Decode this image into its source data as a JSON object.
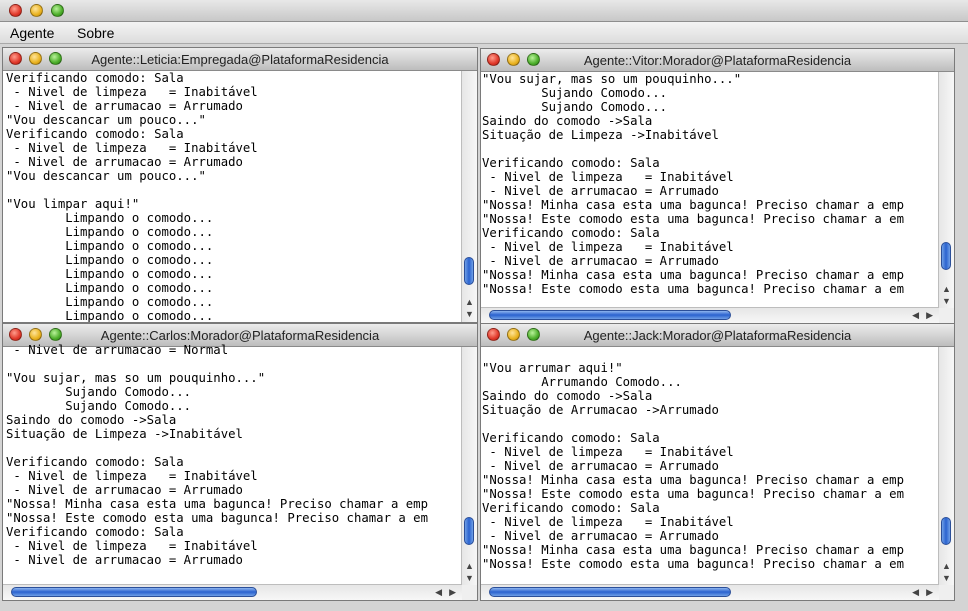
{
  "menubar": {
    "items": [
      "Agente",
      "Sobre"
    ]
  },
  "windows": [
    {
      "title": "Agente::Leticia:Empregada@PlataformaResidencia",
      "lines": [
        "Verificando comodo: Sala",
        " - Nivel de limpeza   = Inabitável",
        " - Nivel de arrumacao = Arrumado",
        "\"Vou descancar um pouco...\"",
        "Verificando comodo: Sala",
        " - Nivel de limpeza   = Inabitável",
        " - Nivel de arrumacao = Arrumado",
        "\"Vou descancar um pouco...\"",
        "",
        "\"Vou limpar aqui!\"",
        "        Limpando o comodo...",
        "        Limpando o comodo...",
        "        Limpando o comodo...",
        "        Limpando o comodo...",
        "        Limpando o comodo...",
        "        Limpando o comodo...",
        "        Limpando o comodo...",
        "        Limpando o comodo..."
      ]
    },
    {
      "title": "Agente::Vitor:Morador@PlataformaResidencia",
      "lines": [
        "\"Vou sujar, mas so um pouquinho...\"",
        "        Sujando Comodo...",
        "        Sujando Comodo...",
        "Saindo do comodo ->Sala",
        "Situação de Limpeza ->Inabitável",
        "",
        "Verificando comodo: Sala",
        " - Nivel de limpeza   = Inabitável",
        " - Nivel de arrumacao = Arrumado",
        "\"Nossa! Minha casa esta uma bagunca! Preciso chamar a emp",
        "\"Nossa! Este comodo esta uma bagunca! Preciso chamar a em",
        "Verificando comodo: Sala",
        " - Nivel de limpeza   = Inabitável",
        " - Nivel de arrumacao = Arrumado",
        "\"Nossa! Minha casa esta uma bagunca! Preciso chamar a emp",
        "\"Nossa! Este comodo esta uma bagunca! Preciso chamar a em"
      ]
    },
    {
      "title": "Agente::Carlos:Morador@PlataformaResidencia",
      "lines": [
        " - Nivel de arrumacao = Normal",
        "",
        "\"Vou sujar, mas so um pouquinho...\"",
        "        Sujando Comodo...",
        "        Sujando Comodo...",
        "Saindo do comodo ->Sala",
        "Situação de Limpeza ->Inabitável",
        "",
        "Verificando comodo: Sala",
        " - Nivel de limpeza   = Inabitável",
        " - Nivel de arrumacao = Arrumado",
        "\"Nossa! Minha casa esta uma bagunca! Preciso chamar a emp",
        "\"Nossa! Este comodo esta uma bagunca! Preciso chamar a em",
        "Verificando comodo: Sala",
        " - Nivel de limpeza   = Inabitável",
        " - Nivel de arrumacao = Arrumado"
      ]
    },
    {
      "title": "Agente::Jack:Morador@PlataformaResidencia",
      "lines": [
        "",
        "\"Vou arrumar aqui!\"",
        "        Arrumando Comodo...",
        "Saindo do comodo ->Sala",
        "Situação de Arrumacao ->Arrumado",
        "",
        "Verificando comodo: Sala",
        " - Nivel de limpeza   = Inabitável",
        " - Nivel de arrumacao = Arrumado",
        "\"Nossa! Minha casa esta uma bagunca! Preciso chamar a emp",
        "\"Nossa! Este comodo esta uma bagunca! Preciso chamar a em",
        "Verificando comodo: Sala",
        " - Nivel de limpeza   = Inabitável",
        " - Nivel de arrumacao = Arrumado",
        "\"Nossa! Minha casa esta uma bagunca! Preciso chamar a emp",
        "\"Nossa! Este comodo esta uma bagunca! Preciso chamar a em"
      ]
    }
  ]
}
